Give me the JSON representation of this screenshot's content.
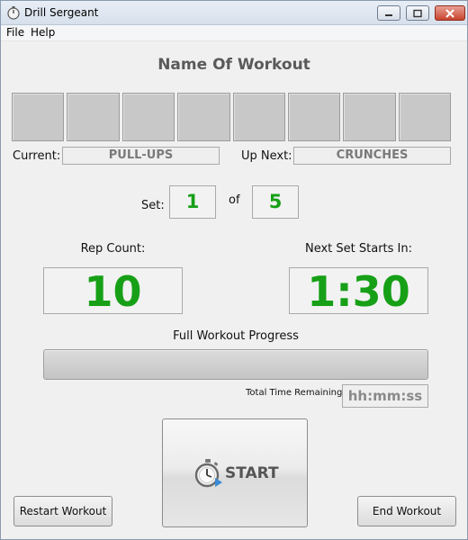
{
  "window": {
    "title": "Drill Sergeant"
  },
  "menu": {
    "items": [
      "File",
      "Help"
    ]
  },
  "workout": {
    "name": "Name Of Workout",
    "step_count": 8
  },
  "exercise": {
    "current_label": "Current:",
    "current_value": "PULL-UPS",
    "next_label": "Up Next:",
    "next_value": "CRUNCHES"
  },
  "set": {
    "label": "Set:",
    "current": "1",
    "of_label": "of",
    "total": "5"
  },
  "rep": {
    "label": "Rep Count:",
    "value": "10"
  },
  "timer": {
    "label": "Next Set Starts In:",
    "value": "1:30"
  },
  "progress": {
    "label": "Full Workout Progress",
    "fraction": 0
  },
  "time_remaining": {
    "label": "Total Time Remaining:",
    "value": "hh:mm:ss"
  },
  "buttons": {
    "start": "START",
    "restart": "Restart Workout",
    "end": "End Workout"
  },
  "colors": {
    "accent_green": "#17a017",
    "title_gray": "#5a5a5a",
    "step_box": "#c8c8c8"
  }
}
